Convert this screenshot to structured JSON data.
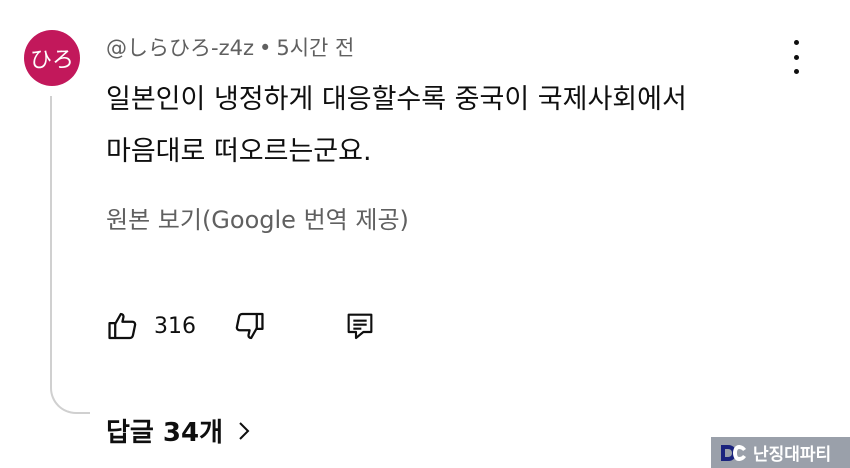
{
  "comment": {
    "avatar_text": "ひろ",
    "avatar_color": "#c2185b",
    "author": "@しらひろ-z4z",
    "separator": "•",
    "time": "5시간 전",
    "text_lines": [
      "일본인이 냉정하게 대응할수록 중국이 국제사회에서",
      "마음대로 떠오르는군요."
    ],
    "translate_link": "원본 보기(Google 번역 제공)",
    "likes": "316",
    "replies_label": "답글 34개"
  },
  "icons": {
    "menu": "more-vert-icon",
    "like": "thumbs-up-icon",
    "dislike": "thumbs-down-icon",
    "reply": "reply-comment-icon",
    "replies_chevron": "chevron-right-icon"
  },
  "watermark": {
    "text": "난징대파티"
  }
}
